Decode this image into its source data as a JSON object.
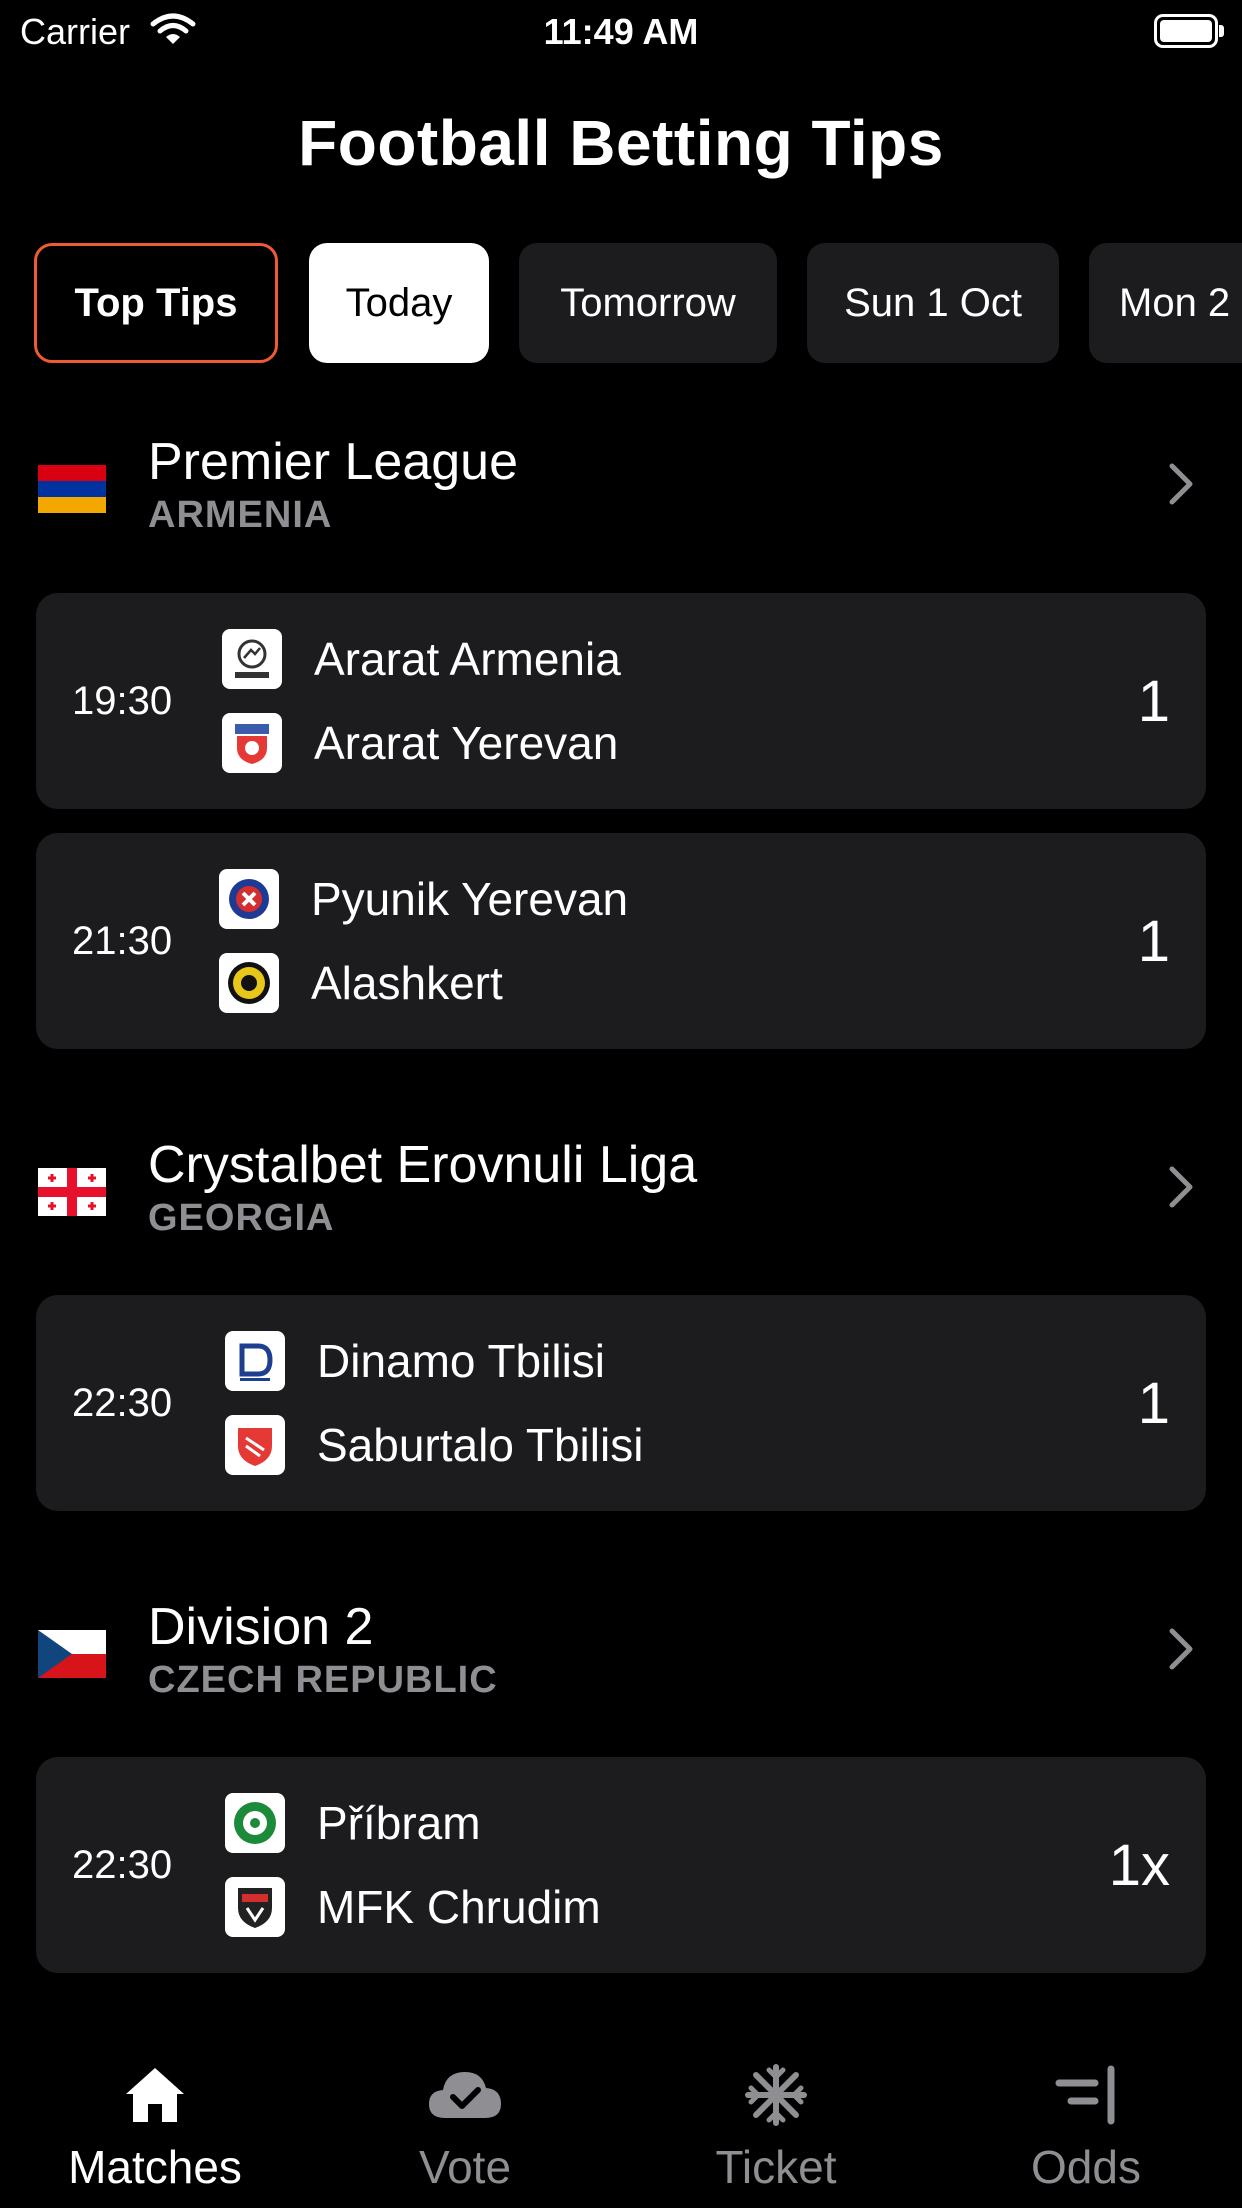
{
  "status_bar": {
    "carrier": "Carrier",
    "time": "11:49 AM"
  },
  "title": "Football Betting Tips",
  "tabs": [
    {
      "label": "Top Tips"
    },
    {
      "label": "Today"
    },
    {
      "label": "Tomorrow"
    },
    {
      "label": "Sun 1 Oct"
    },
    {
      "label": "Mon 2"
    }
  ],
  "leagues": [
    {
      "name": "Premier League",
      "country": "ARMENIA",
      "matches": [
        {
          "time": "19:30",
          "home": "Ararat Armenia",
          "away": "Ararat Yerevan",
          "tip": "1"
        },
        {
          "time": "21:30",
          "home": "Pyunik Yerevan",
          "away": "Alashkert",
          "tip": "1"
        }
      ]
    },
    {
      "name": "Crystalbet Erovnuli Liga",
      "country": "GEORGIA",
      "matches": [
        {
          "time": "22:30",
          "home": "Dinamo Tbilisi",
          "away": "Saburtalo Tbilisi",
          "tip": "1"
        }
      ]
    },
    {
      "name": "Division 2",
      "country": "CZECH REPUBLIC",
      "matches": [
        {
          "time": "22:30",
          "home": "Příbram",
          "away": "MFK Chrudim",
          "tip": "1x"
        }
      ]
    }
  ],
  "nav": [
    {
      "label": "Matches",
      "icon": "home-icon"
    },
    {
      "label": "Vote",
      "icon": "cloud-check-icon"
    },
    {
      "label": "Ticket",
      "icon": "snowflake-icon"
    },
    {
      "label": "Odds",
      "icon": "odds-icon"
    }
  ],
  "colors": {
    "accent": "#f05a33",
    "card": "#1c1c1e",
    "muted": "#8e8e93"
  }
}
